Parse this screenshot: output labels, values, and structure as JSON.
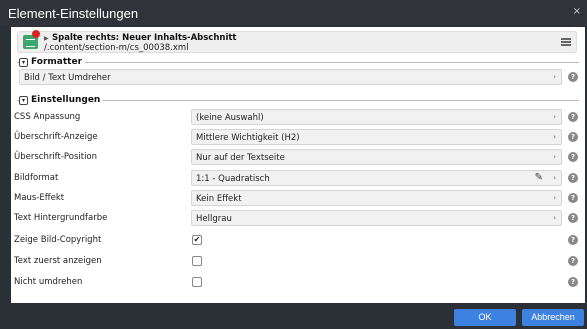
{
  "window": {
    "title": "Element-Einstellungen",
    "close_glyph": "×"
  },
  "crumb": {
    "name": "Spalte rechts: Neuer Inhalts-Abschnitt",
    "path": "/.content/section-m/cs_00038.xml"
  },
  "formatter": {
    "legend": "Formatter",
    "value": "Bild / Text Umdreher"
  },
  "settings": {
    "legend": "Einstellungen",
    "rows": [
      {
        "label": "CSS Anpassung",
        "value": "(keine Auswahl)"
      },
      {
        "label": "Überschrift-Anzeige",
        "value": "Mittlere Wichtigkeit (H2)"
      },
      {
        "label": "Überschrift-Position",
        "value": "Nur auf der Textseite"
      },
      {
        "label": "Bildformat",
        "value": "1:1 - Quadratisch"
      },
      {
        "label": "Maus-Effekt",
        "value": "Kein Effekt"
      },
      {
        "label": "Text Hintergrundfarbe",
        "value": "Hellgrau"
      },
      {
        "label": "Zeige Bild-Copyright",
        "checked": true
      },
      {
        "label": "Text zuerst anzeigen",
        "checked": false
      },
      {
        "label": "Nicht umdrehen",
        "checked": false
      }
    ]
  },
  "glyphs": {
    "toggle": "▾",
    "arrow": "›",
    "help": "?",
    "check": "✔",
    "pencil": "✎",
    "tri": "▶"
  },
  "buttons": {
    "ok": "OK",
    "cancel": "Abbrechen"
  },
  "colors": {
    "accent": "#3d82e0",
    "titlebar": "#30343a",
    "logo": "#3aa76d",
    "badge": "#dd2222"
  },
  "icons": [
    "element-logo-icon",
    "chevron-right-icon",
    "hamburger-menu-icon",
    "help-icon",
    "pencil-icon",
    "checkmark-icon",
    "close-icon"
  ]
}
